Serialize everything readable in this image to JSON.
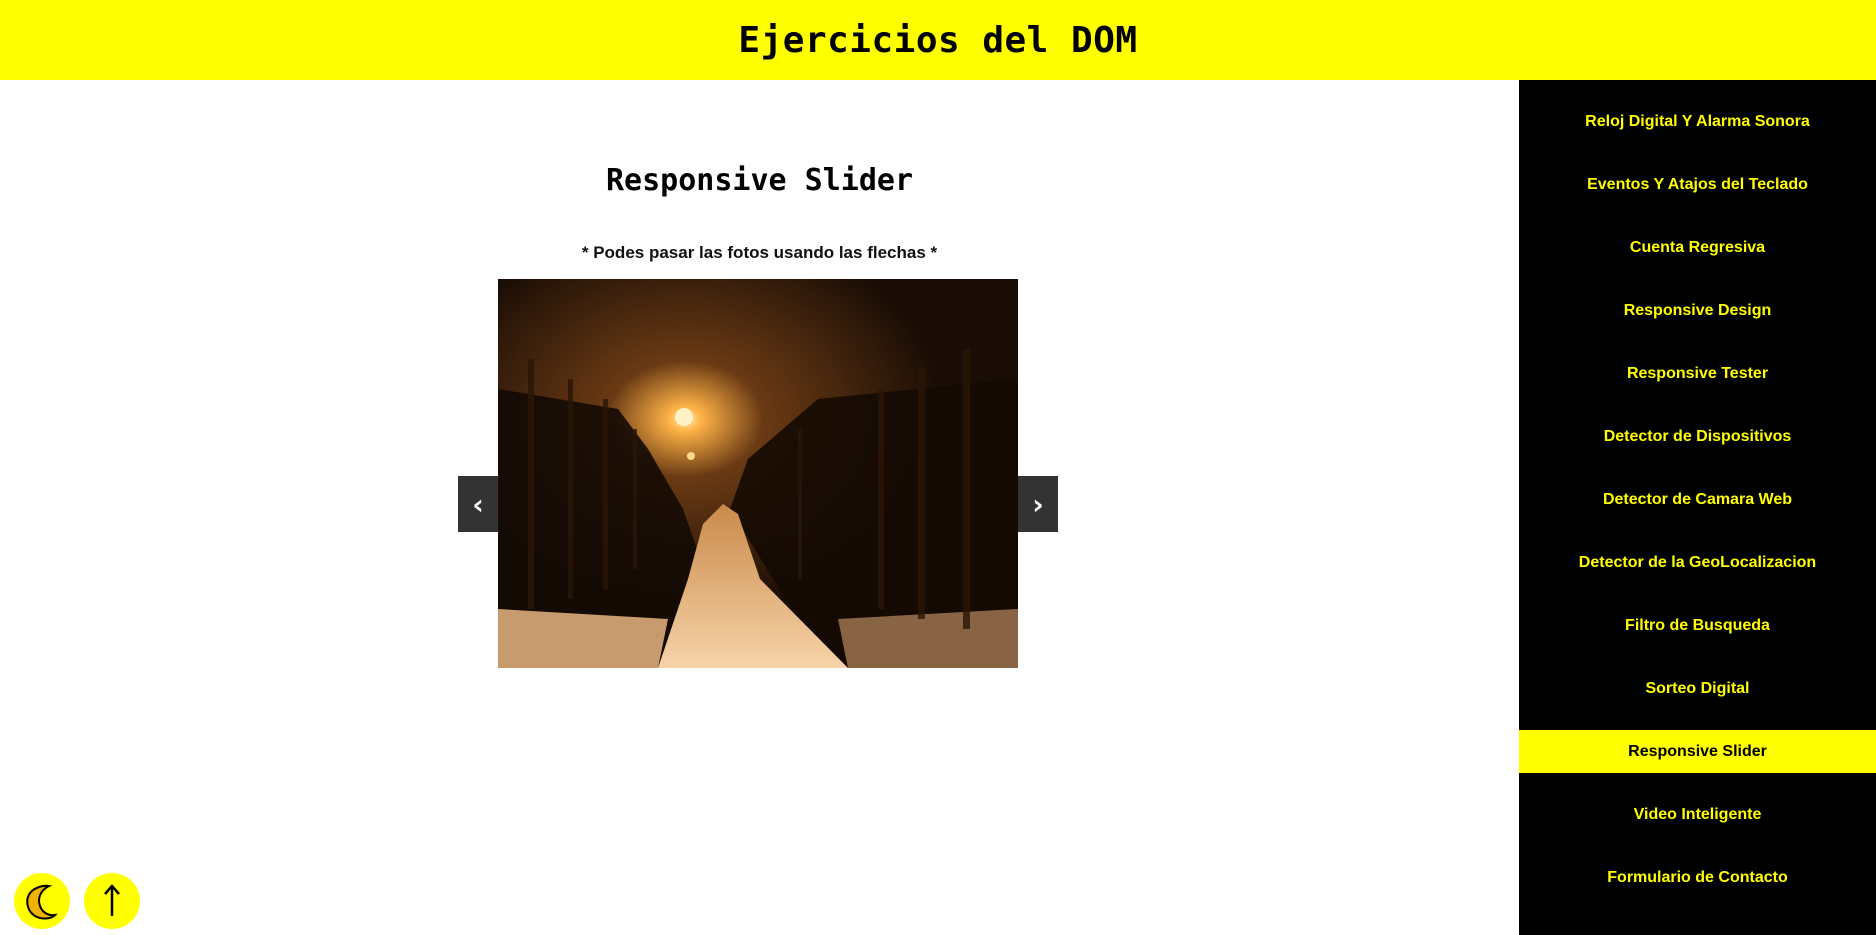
{
  "header": {
    "title": "Ejercicios del DOM"
  },
  "main": {
    "title": "Responsive Slider",
    "hint": "* Podes pasar las fotos usando las flechas *",
    "slider": {
      "prev_label": "‹",
      "next_label": "›",
      "current_image": "snowy-tree-lined-path-at-night"
    }
  },
  "sidebar": {
    "items": [
      {
        "label": "Reloj Digital Y Alarma Sonora"
      },
      {
        "label": "Eventos Y Atajos del Teclado"
      },
      {
        "label": "Cuenta Regresiva"
      },
      {
        "label": "Responsive Design"
      },
      {
        "label": "Responsive Tester"
      },
      {
        "label": "Detector de Dispositivos"
      },
      {
        "label": "Detector de Camara Web"
      },
      {
        "label": "Detector de la GeoLocalizacion"
      },
      {
        "label": "Filtro de Busqueda"
      },
      {
        "label": "Sorteo Digital"
      },
      {
        "label": "Responsive Slider",
        "active": true
      },
      {
        "label": "Video Inteligente"
      },
      {
        "label": "Formulario de Contacto"
      }
    ]
  },
  "buttons": {
    "theme_icon": "moon-icon",
    "scroll_top_icon": "arrow-up-icon"
  },
  "colors": {
    "accent": "#ffff00",
    "sidebar_bg": "#000000",
    "arrow_bg": "#333333"
  }
}
